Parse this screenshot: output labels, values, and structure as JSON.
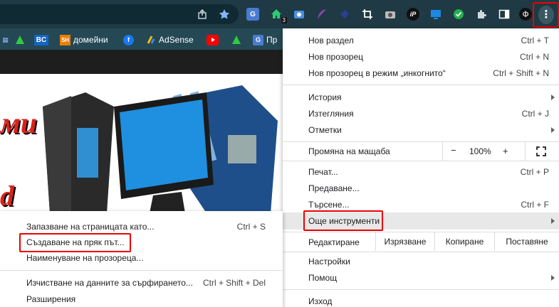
{
  "toolbar": {
    "extension_badge": "3",
    "profile_letter": "Ф"
  },
  "bookmarks": [
    {
      "label": "BC",
      "icon": "bc-logo"
    },
    {
      "label": "SH",
      "icon": "sh-logo"
    },
    {
      "label": "домейни"
    },
    {
      "label": "AdSense"
    },
    {
      "label": "Пр"
    }
  ],
  "page": {
    "text_1": "ми",
    "text_2": "d"
  },
  "main_menu": {
    "new_tab": "Нов раздел",
    "new_tab_sc": "Ctrl + T",
    "new_window": "Нов прозорец",
    "new_window_sc": "Ctrl + N",
    "incognito": "Нов прозорец в режим „инкогнито“",
    "incognito_sc": "Ctrl + Shift + N",
    "history": "История",
    "downloads": "Изтегляния",
    "downloads_sc": "Ctrl + J",
    "bookmarks": "Отметки",
    "zoom_label": "Промяна на мащаба",
    "zoom_minus": "−",
    "zoom_value": "100%",
    "zoom_plus": "+",
    "print": "Печат...",
    "print_sc": "Ctrl + P",
    "cast": "Предаване...",
    "find": "Търсене...",
    "find_sc": "Ctrl + F",
    "more_tools": "Още инструменти",
    "edit": "Редактиране",
    "cut": "Изрязване",
    "copy": "Копиране",
    "paste": "Поставяне",
    "settings": "Настройки",
    "help": "Помощ",
    "exit": "Изход"
  },
  "sub_menu": {
    "save_page": "Запазване на страницата като...",
    "save_page_sc": "Ctrl + S",
    "create_shortcut": "Създаване на пряк път...",
    "name_window": "Наименуване на прозореца...",
    "clear_data": "Изчистване на данните за сърфирането...",
    "clear_data_sc": "Ctrl + Shift + Del",
    "extensions": "Разширения"
  }
}
